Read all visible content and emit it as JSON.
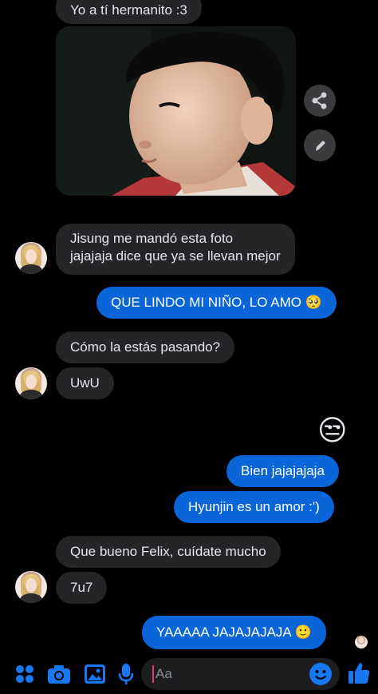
{
  "messages": {
    "m1": "Yo a tí hermanito :3",
    "m2_line1": "Jisung me mandó esta foto",
    "m2_line2": "jajajaja dice que ya se llevan mejor",
    "m3": "QUE LINDO MI NIÑO, LO AMO 🥺",
    "m4": "Cómo la estás pasando?",
    "m5": "UwU",
    "m6_emoji": "😒",
    "m7": "Bien jajajajaja",
    "m8": "Hyunjin es un amor :')",
    "m9": "Que bueno Felix, cuídate mucho",
    "m10": "7u7",
    "m11": "YAAAAA JAJAJAJAJA 🙂"
  },
  "composer": {
    "placeholder": "Aa"
  },
  "icons": {
    "share": "share-icon",
    "edit": "pencil-icon",
    "apps": "apps-grid-icon",
    "camera": "camera-icon",
    "gallery": "gallery-icon",
    "mic": "microphone-icon",
    "emoji": "smiley-icon",
    "like": "thumbs-up-icon"
  },
  "colors": {
    "accent": "#0a66d8",
    "incoming_bubble": "#242526",
    "background": "#000000",
    "icon_blue": "#1877f2"
  }
}
